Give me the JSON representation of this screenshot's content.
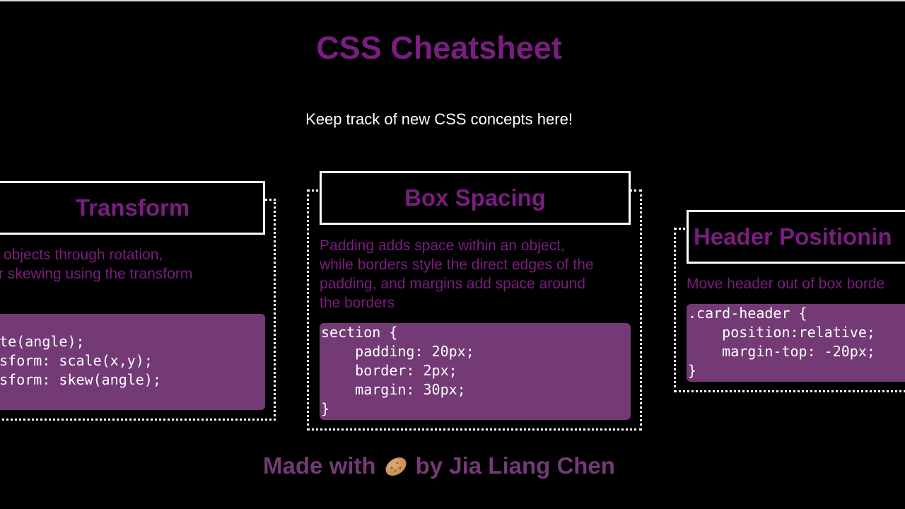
{
  "header": {
    "title": "CSS Cheatsheet",
    "subtitle": "Keep track of new CSS concepts here!"
  },
  "cards": [
    {
      "title": "Transform",
      "description": "orm objects through rotation,\ng, or skewing using the transform\nty",
      "code": "otate(angle);\nransform: scale(x,y);\nransform: skew(angle);"
    },
    {
      "title": "Box Spacing",
      "description": "Padding adds space within an object,\nwhile borders style the direct edges of the\npadding, and margins add space around\nthe borders",
      "code": "section {\n    padding: 20px;\n    border: 2px;\n    margin: 30px;\n}"
    },
    {
      "title": "Header Positionin",
      "description": "Move header out of box borde",
      "code": ".card-header {\n    position:relative;\n    margin-top: -20px;\n}"
    }
  ],
  "footer": {
    "prefix": "Made with",
    "icon": "potato-icon",
    "suffix": "by Jia Liang Chen"
  },
  "colors": {
    "background": "#000000",
    "accent": "#7a1d80",
    "code_background": "#733a75",
    "text": "#ffffff"
  }
}
